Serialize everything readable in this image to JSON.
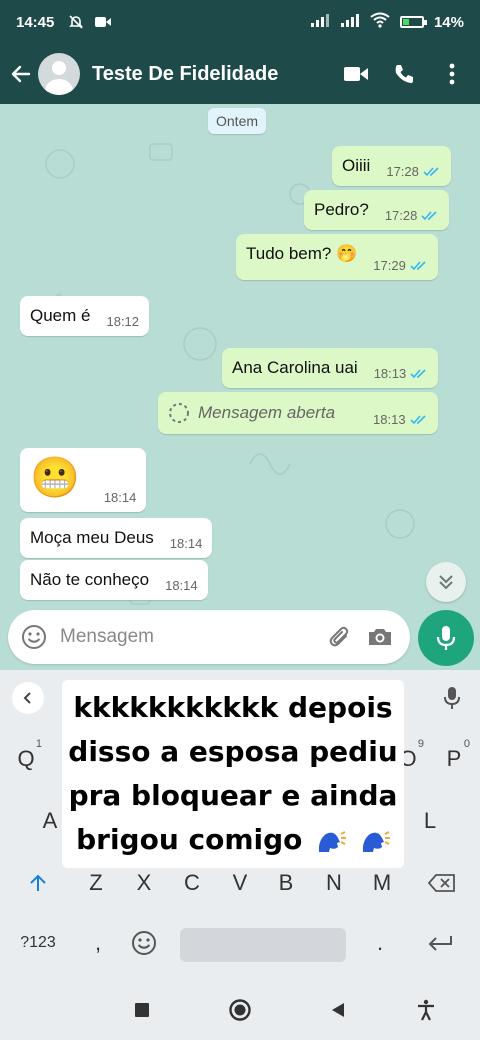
{
  "status": {
    "time": "14:45",
    "battery_pct": "14%"
  },
  "header": {
    "title": "Teste De Fidelidade"
  },
  "chat": {
    "date_chip": "Ontem",
    "messages": [
      {
        "dir": "out",
        "text": "Oiiii",
        "time": "17:28"
      },
      {
        "dir": "out",
        "text": "Pedro?",
        "time": "17:28"
      },
      {
        "dir": "out",
        "text": "Tudo bem? 🤭",
        "time": "17:29"
      },
      {
        "dir": "in",
        "text": "Quem é",
        "time": "18:12"
      },
      {
        "dir": "out",
        "text": "Ana Carolina uai",
        "time": "18:13"
      },
      {
        "dir": "out",
        "text": "Mensagem aberta",
        "time": "18:13",
        "style": "view-once"
      },
      {
        "dir": "in",
        "text": "😬",
        "time": "18:14"
      },
      {
        "dir": "in",
        "text": "Moça meu Deus",
        "time": "18:14"
      },
      {
        "dir": "in",
        "text": "Não te conheço",
        "time": "18:14"
      }
    ]
  },
  "input": {
    "placeholder": "Mensagem"
  },
  "keyboard": {
    "row1": [
      {
        "key": "Q",
        "sup": "1"
      },
      {
        "key": "O",
        "sup": "9"
      },
      {
        "key": "P",
        "sup": "0"
      }
    ],
    "row2": [
      "A",
      "L"
    ],
    "row3": [
      "Z",
      "X",
      "C",
      "V",
      "B",
      "N",
      "M"
    ],
    "row4": {
      "sym": "?123",
      "comma": ",",
      "period": "."
    }
  },
  "caption": {
    "lines": [
      "kkkkkkkkkkk depois",
      "disso a esposa pediu",
      "pra bloquear e ainda",
      "brigou comigo"
    ]
  },
  "colors": {
    "header_bg": "#1f4a4a",
    "chat_bg": "#b8ddd4",
    "outgoing_bubble": "#dcf8c6",
    "incoming_bubble": "#ffffff",
    "accent": "#1fa57e",
    "read_ticks": "#34b7f1"
  }
}
